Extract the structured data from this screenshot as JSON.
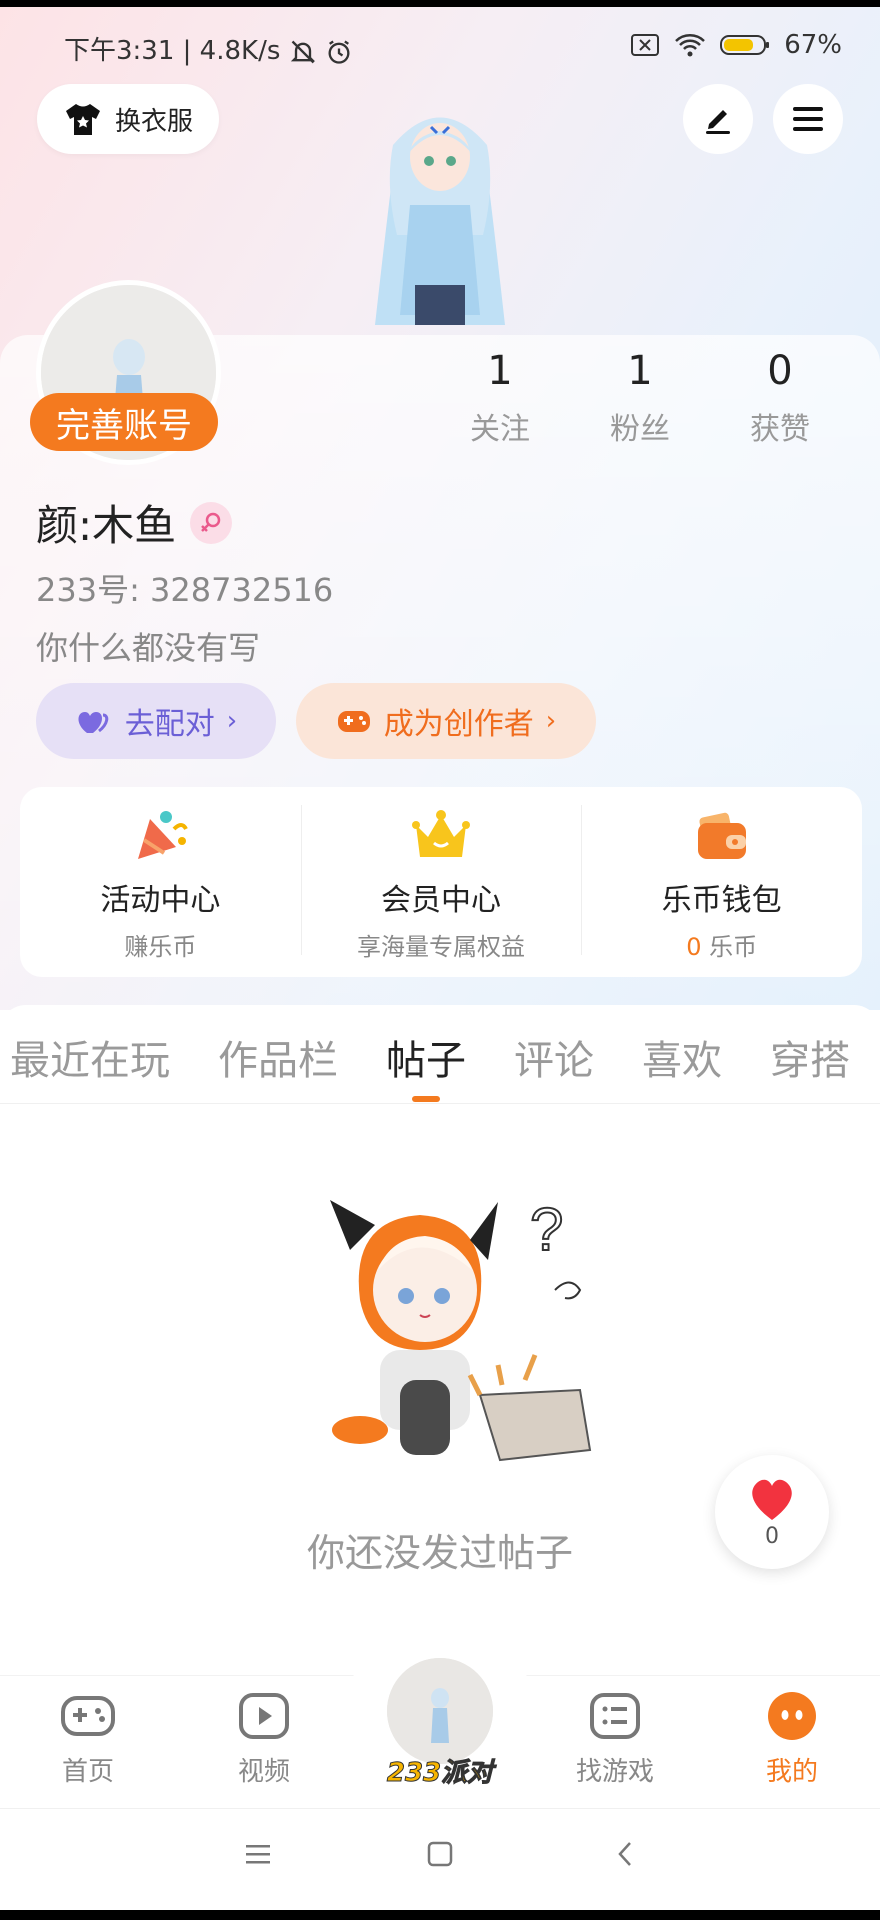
{
  "status_bar": {
    "time_speed": "下午3:31 | 4.8K/s",
    "battery": "67%"
  },
  "header": {
    "outfit_label": "换衣服"
  },
  "profile": {
    "complete_account_label": "完善账号",
    "stats": [
      {
        "value": "1",
        "label": "关注"
      },
      {
        "value": "1",
        "label": "粉丝"
      },
      {
        "value": "0",
        "label": "获赞"
      }
    ],
    "username": "颜:木鱼",
    "uid": "233号: 328732516",
    "bio": "你什么都没有写",
    "pair_label": "去配对",
    "creator_label": "成为创作者"
  },
  "features": [
    {
      "title": "活动中心",
      "sub": "赚乐币",
      "icon": "party-popper-icon"
    },
    {
      "title": "会员中心",
      "sub": "享海量专属权益",
      "icon": "crown-icon"
    },
    {
      "title": "乐币钱包",
      "sub_num": "0",
      "sub": "乐币",
      "icon": "wallet-icon"
    }
  ],
  "tabs": [
    "最近在玩",
    "作品栏",
    "帖子",
    "评论",
    "喜欢",
    "穿搭"
  ],
  "active_tab": "帖子",
  "empty_state": {
    "text": "你还没发过帖子"
  },
  "like_float": {
    "count": "0"
  },
  "bottom_nav": {
    "items": [
      {
        "label": "首页",
        "icon": "gamepad-icon"
      },
      {
        "label": "视频",
        "icon": "play-icon"
      },
      {
        "label": "233派对",
        "icon": "party-avatar"
      },
      {
        "label": "找游戏",
        "icon": "list-icon"
      },
      {
        "label": "我的",
        "icon": "me-icon"
      }
    ]
  },
  "colors": {
    "accent": "#f47a1f",
    "pair_purple": "#6b5fd6"
  }
}
